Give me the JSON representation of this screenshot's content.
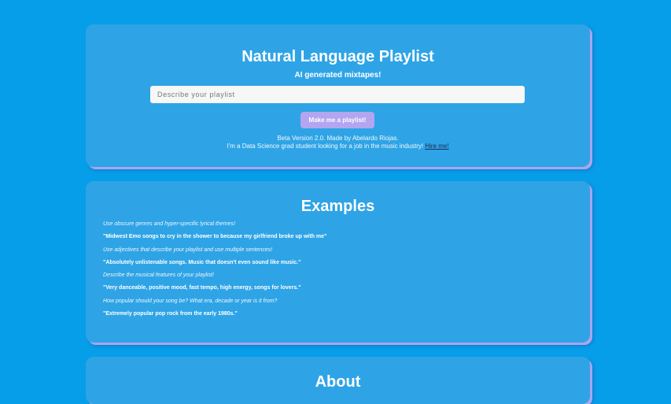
{
  "header": {
    "title": "Natural Language Playlist",
    "subtitle": "AI generated mixtapes!"
  },
  "search": {
    "placeholder": "Describe your playlist",
    "value": ""
  },
  "actions": {
    "make_playlist_label": "Make me a playlist!"
  },
  "footer": {
    "version_line": "Beta Version 2.0. Made by Abelardo Riojas.",
    "bio_line": "I'm a Data Science grad student looking for a job in the music industry! ",
    "hire_link": "Hire me!"
  },
  "examples": {
    "title": "Examples",
    "items": [
      {
        "hint": "Use obscure genres and hyper-specific lyrical themes!",
        "example": "\"Midwest Emo songs to cry in the shower to because my girlfriend broke up with me\""
      },
      {
        "hint": "Use adjectives that describe your playlist and use multiple sentences!",
        "example": "\"Absolutely unlistenable songs. Music that doesn't even sound like music.\""
      },
      {
        "hint": "Describe the musical features of your playlist!",
        "example": "\"Very danceable, positive mood, fast tempo, high energy, songs for lovers.\""
      },
      {
        "hint": "How popular should your song be? What era, decade or year is it from?",
        "example": "\"Extremely popular pop rock from the early 1980s.\""
      }
    ]
  },
  "about": {
    "title": "About"
  },
  "colors": {
    "background": "#069ee8",
    "card": "#2ea4e6",
    "card_shadow": "#a9a6ef",
    "button": "#b3a5f0"
  }
}
